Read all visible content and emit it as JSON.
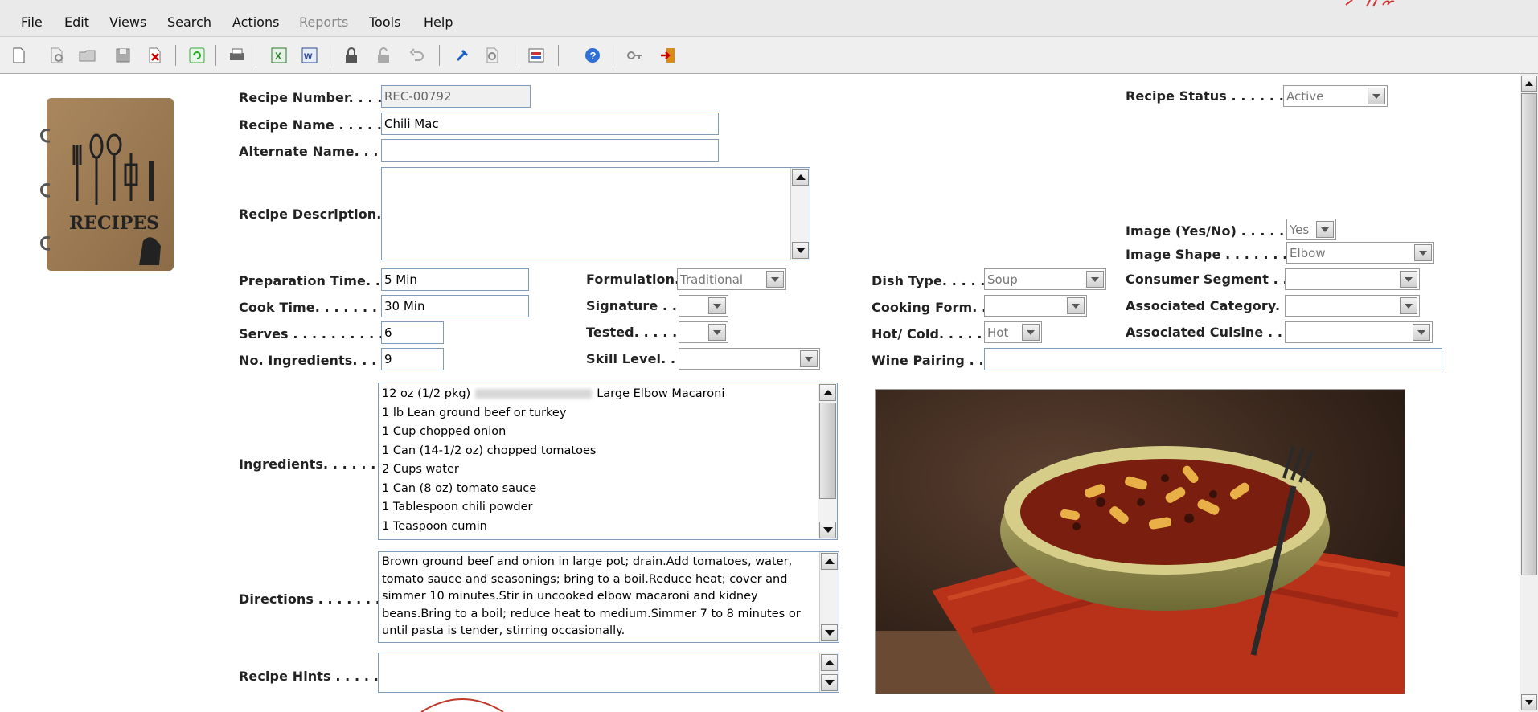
{
  "menu": {
    "file": "File",
    "edit": "Edit",
    "views": "Views",
    "search": "Search",
    "actions": "Actions",
    "reports": "Reports",
    "tools": "Tools",
    "help": "Help"
  },
  "toolbar_icons": [
    "new-document-icon",
    "preview-icon",
    "open-folder-icon",
    "save-icon",
    "delete-icon",
    "refresh-icon",
    "print-icon",
    "excel-icon",
    "word-icon",
    "lock-icon",
    "unlock-icon",
    "undo-icon",
    "pin-icon",
    "find-icon",
    "report-icon",
    "help-icon",
    "key-icon",
    "exit-icon"
  ],
  "cover": {
    "text": "RECIPES"
  },
  "labels": {
    "recipe_number": "Recipe Number. . . . .",
    "recipe_name": "Recipe Name . . . . . . .",
    "alternate_name": "Alternate Name. . . . .",
    "recipe_description": "Recipe Description. .",
    "preparation_time": "Preparation Time. . .",
    "cook_time": "Cook Time. . . . . . . . .",
    "serves": "Serves . . . . . . . . . . . .",
    "no_ingredients": "No. Ingredients. . . . .",
    "ingredients": "Ingredients. . . . . . . .",
    "directions": "Directions . . . . . . . . .",
    "recipe_hints": "Recipe Hints . . . . . . .",
    "formulation": "Formulation.",
    "signature": "Signature . . .",
    "tested": "Tested. . . . . .",
    "skill_level": "Skill Level. . .",
    "dish_type": "Dish Type. . . . . .",
    "cooking_form": "Cooking Form. .",
    "hot_cold": "Hot/ Cold. . . . . . .",
    "wine_pairing": "Wine Pairing . . .",
    "recipe_status": "Recipe Status . . . . . . . .",
    "image_yes_no": "Image (Yes/No) . . . . . . .",
    "image_shape": "Image Shape . . . . . . . . .",
    "consumer_segment": "Consumer Segment . .",
    "associated_category": "Associated Category. .",
    "associated_cuisine": "Associated Cuisine . . ."
  },
  "values": {
    "recipe_number": "REC-00792",
    "recipe_name": "Chili Mac",
    "alternate_name": "",
    "recipe_description": "",
    "preparation_time": "5 Min",
    "cook_time": "30 Min",
    "serves": "6",
    "no_ingredients": "9",
    "formulation": "Traditional",
    "signature": "",
    "tested": "",
    "skill_level": "",
    "dish_type": "Soup",
    "cooking_form": "",
    "hot_cold": "Hot",
    "wine_pairing": "",
    "recipe_status": "Active",
    "image_yes_no": "Yes",
    "image_shape": "Elbow",
    "consumer_segment": "",
    "associated_category": "",
    "associated_cuisine": "",
    "recipe_hints": ""
  },
  "ingredients": [
    {
      "pre": "12 oz (1/2 pkg)",
      "post": "Large Elbow Macaroni"
    },
    {
      "pre": "1 lb Lean ground beef or turkey",
      "post": ""
    },
    {
      "pre": "1 Cup chopped onion",
      "post": ""
    },
    {
      "pre": "1 Can (14-1/2 oz) chopped tomatoes",
      "post": ""
    },
    {
      "pre": "2 Cups water",
      "post": ""
    },
    {
      "pre": "1 Can (8 oz) tomato sauce",
      "post": ""
    },
    {
      "pre": "1 Tablespoon chili powder",
      "post": ""
    },
    {
      "pre": "1 Teaspoon cumin",
      "post": ""
    }
  ],
  "directions": "Brown ground beef and onion in large pot; drain.Add tomatoes, water, tomato sauce and seasonings; bring to a boil.Reduce heat; cover and simmer 10 minutes.Stir in uncooked elbow macaroni and kidney beans.Bring to a boil; reduce heat to medium.Simmer 7 to 8 minutes or until pasta is tender, stirring occasionally."
}
